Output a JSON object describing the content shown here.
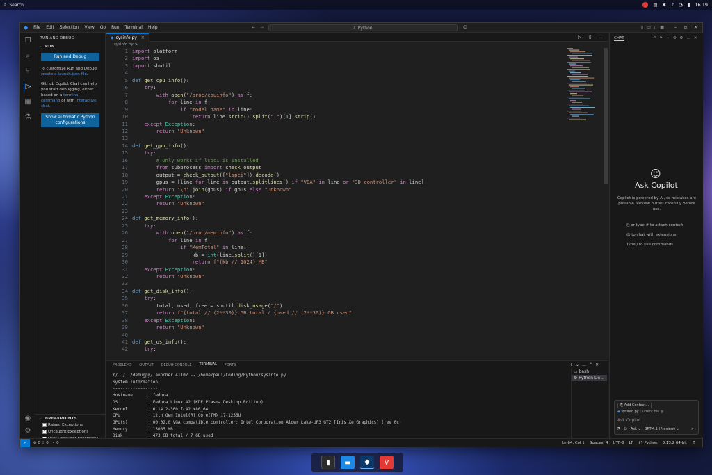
{
  "desktop": {
    "search_label": "Search",
    "clock": "16.19"
  },
  "window": {
    "menu": [
      "File",
      "Edit",
      "Selection",
      "View",
      "Go",
      "Run",
      "Terminal",
      "Help"
    ],
    "command_center": "Python",
    "sidebar": {
      "title": "RUN AND DEBUG",
      "section": "RUN",
      "run_button": "Run and Debug",
      "customize_text": "To customize Run and Debug",
      "create_link": "create a launch.json file",
      "copilot_text1": "GitHub Copilot Chat can help you start debugging, either based on a",
      "terminal_link": "terminal command",
      "or_with": "or with",
      "interactive_link": "interactive chat",
      "python_button": "Show automatic Python configurations",
      "breakpoints_title": "BREAKPOINTS",
      "breakpoints": [
        {
          "label": "Raised Exceptions",
          "checked": false
        },
        {
          "label": "Uncaught Exceptions",
          "checked": true
        },
        {
          "label": "User Uncaught Exceptions",
          "checked": false
        }
      ]
    },
    "editor": {
      "tab": "sysinfo.py",
      "breadcrumb": "sysinfo.py > ...",
      "lines": [
        {
          "n": "1",
          "h": "<span class='kw'>import</span> platform"
        },
        {
          "n": "2",
          "h": "<span class='kw'>import</span> os"
        },
        {
          "n": "3",
          "h": "<span class='kw'>import</span> shutil"
        },
        {
          "n": "4",
          "h": ""
        },
        {
          "n": "5",
          "h": "<span class='kb'>def</span> <span class='fn'>get_cpu_info</span>():"
        },
        {
          "n": "6",
          "h": "    <span class='kw'>try</span>:"
        },
        {
          "n": "7",
          "h": "        <span class='kw'>with</span> <span class='fn'>open</span>(<span class='st'>\"/proc/cpuinfo\"</span>) <span class='kw'>as</span> f:"
        },
        {
          "n": "8",
          "h": "            <span class='kw'>for</span> line <span class='kw'>in</span> f:"
        },
        {
          "n": "9",
          "h": "                <span class='kw'>if</span> <span class='st'>\"model name\"</span> <span class='kw'>in</span> line:"
        },
        {
          "n": "10",
          "h": "                    <span class='kw'>return</span> line.<span class='fn'>strip</span>().<span class='fn'>split</span>(<span class='st'>\":\"</span>)[<span class='nm'>1</span>].<span class='fn'>strip</span>()"
        },
        {
          "n": "11",
          "h": "    <span class='kw'>except</span> <span class='cl'>Exception</span>:"
        },
        {
          "n": "12",
          "h": "        <span class='kw'>return</span> <span class='st'>\"Unknown\"</span>"
        },
        {
          "n": "13",
          "h": ""
        },
        {
          "n": "14",
          "h": "<span class='kb'>def</span> <span class='fn'>get_gpu_info</span>():"
        },
        {
          "n": "15",
          "h": "    <span class='kw'>try</span>:"
        },
        {
          "n": "16",
          "h": "        <span class='cm'># Only works if lspci is installed</span>"
        },
        {
          "n": "17",
          "h": "        <span class='kw'>from</span> subprocess <span class='kw'>import</span> <span class='fn'>check_output</span>"
        },
        {
          "n": "18",
          "h": "        output = <span class='fn'>check_output</span>([<span class='st'>\"lspci\"</span>]).<span class='fn'>decode</span>()"
        },
        {
          "n": "19",
          "h": "        gpus = [line <span class='kw'>for</span> line <span class='kw'>in</span> output.<span class='fn'>splitlines</span>() <span class='kw'>if</span> <span class='st'>\"VGA\"</span> <span class='kw'>in</span> line <span class='kw'>or</span> <span class='st'>\"3D controller\"</span> <span class='kw'>in</span> line]"
        },
        {
          "n": "20",
          "h": "        <span class='kw'>return</span> <span class='st'>\"\\n\"</span>.<span class='fn'>join</span>(gpus) <span class='kw'>if</span> gpus <span class='kw'>else</span> <span class='st'>\"Unknown\"</span>"
        },
        {
          "n": "21",
          "h": "    <span class='kw'>except</span> <span class='cl'>Exception</span>:"
        },
        {
          "n": "22",
          "h": "        <span class='kw'>return</span> <span class='st'>\"Unknown\"</span>"
        },
        {
          "n": "23",
          "h": ""
        },
        {
          "n": "24",
          "h": "<span class='kb'>def</span> <span class='fn'>get_memory_info</span>():"
        },
        {
          "n": "25",
          "h": "    <span class='kw'>try</span>:"
        },
        {
          "n": "26",
          "h": "        <span class='kw'>with</span> <span class='fn'>open</span>(<span class='st'>\"/proc/meminfo\"</span>) <span class='kw'>as</span> f:"
        },
        {
          "n": "27",
          "h": "            <span class='kw'>for</span> line <span class='kw'>in</span> f:"
        },
        {
          "n": "28",
          "h": "                <span class='kw'>if</span> <span class='st'>\"MemTotal\"</span> <span class='kw'>in</span> line:"
        },
        {
          "n": "29",
          "h": "                    kb = <span class='cl'>int</span>(line.<span class='fn'>split</span>()[<span class='nm'>1</span>])"
        },
        {
          "n": "30",
          "h": "                    <span class='kw'>return</span> <span class='st'>f\"{kb // 1024} MB\"</span>"
        },
        {
          "n": "31",
          "h": "    <span class='kw'>except</span> <span class='cl'>Exception</span>:"
        },
        {
          "n": "32",
          "h": "        <span class='kw'>return</span> <span class='st'>\"Unknown\"</span>"
        },
        {
          "n": "33",
          "h": ""
        },
        {
          "n": "34",
          "h": "<span class='kb'>def</span> <span class='fn'>get_disk_info</span>():"
        },
        {
          "n": "35",
          "h": "    <span class='kw'>try</span>:"
        },
        {
          "n": "36",
          "h": "        total, used, free = shutil.<span class='fn'>disk_usage</span>(<span class='st'>\"/\"</span>)"
        },
        {
          "n": "37",
          "h": "        <span class='kw'>return</span> <span class='st'>f\"{total // (2**30)} GB total / {used // (2**30)} GB used\"</span>"
        },
        {
          "n": "38",
          "h": "    <span class='kw'>except</span> <span class='cl'>Exception</span>:"
        },
        {
          "n": "39",
          "h": "        <span class='kw'>return</span> <span class='st'>\"Unknown\"</span>"
        },
        {
          "n": "40",
          "h": ""
        },
        {
          "n": "41",
          "h": "<span class='kb'>def</span> <span class='fn'>get_os_info</span>():"
        },
        {
          "n": "42",
          "h": "    <span class='kw'>try</span>:"
        }
      ]
    },
    "panel": {
      "tabs": [
        "PROBLEMS",
        "OUTPUT",
        "DEBUG CONSOLE",
        "TERMINAL",
        "PORTS"
      ],
      "active_tab": "TERMINAL",
      "output": [
        "r/../../debugpy/launcher 41107 -- /home/paul/Coding/Python/sysinfo.py",
        "System Information",
        "------------------",
        "Hostname      : fedora",
        "OS            : Fedora Linux 42 (KDE Plasma Desktop Edition)",
        "Kernel        : 6.14.2-300.fc42.x86_64",
        "CPU           : 12th Gen Intel(R) Core(TM) i7-1255U",
        "GPU(s)        : 00:02.0 VGA compatible controller: Intel Corporation Alder Lake-UP3 GT2 [Iris Xe Graphics] (rev 0c)",
        "Memory        : 15085 MB",
        "Disk          : 473 GB total / 7 GB used"
      ],
      "prompt": "paul@fedora:~/Coding/Python$",
      "terminals": [
        "bash",
        "Python De..."
      ]
    },
    "chat": {
      "title": "CHAT",
      "heading": "Ask Copilot",
      "disclaimer": "Copilot is powered by AI, so mistakes are possible. Review output carefully before use.",
      "hint1": "or type # to attach context",
      "hint2": "to chat with extensions",
      "hint3": "Type / to use commands",
      "add_context": "Add Context...",
      "file_chip": "sysinfo.py",
      "file_chip_tag": "Current file",
      "input_placeholder": "Ask Copilot",
      "mode": "Ask",
      "model": "GPT-4.1 (Preview)"
    },
    "status": {
      "errors": "0",
      "warnings": "0",
      "ports": "0",
      "position": "Ln 64, Col 1",
      "spaces": "Spaces: 4",
      "encoding": "UTF-8",
      "eol": "LF",
      "language": "Python",
      "interpreter": "3.13.2 64-bit"
    }
  }
}
